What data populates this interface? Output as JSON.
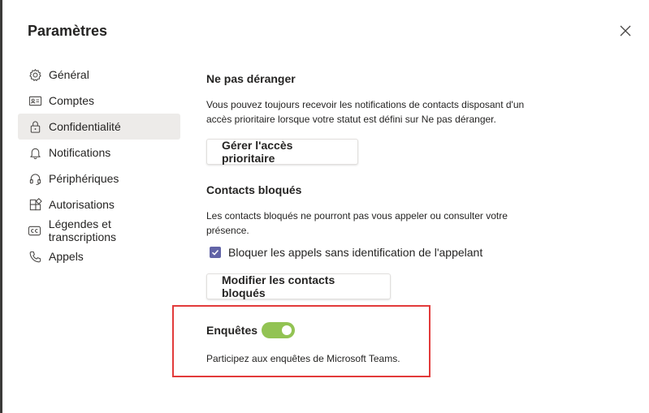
{
  "dialog": {
    "title": "Paramètres"
  },
  "sidebar": {
    "items": [
      {
        "label": "Général",
        "icon": "gear-icon"
      },
      {
        "label": "Comptes",
        "icon": "account-card-icon"
      },
      {
        "label": "Confidentialité",
        "icon": "lock-icon",
        "active": true
      },
      {
        "label": "Notifications",
        "icon": "bell-icon"
      },
      {
        "label": "Périphériques",
        "icon": "headset-icon"
      },
      {
        "label": "Autorisations",
        "icon": "apps-grid-icon"
      },
      {
        "label": "Légendes et transcriptions",
        "icon": "cc-icon"
      },
      {
        "label": "Appels",
        "icon": "phone-icon"
      }
    ]
  },
  "dnd": {
    "title": "Ne pas déranger",
    "description": "Vous pouvez toujours recevoir les notifications de contacts disposant d'un accès prioritaire lorsque votre statut est défini sur Ne pas déranger.",
    "button_label": "Gérer l'accès prioritaire"
  },
  "blocked": {
    "title": "Contacts bloqués",
    "description": "Les contacts bloqués ne pourront pas vous appeler ou consulter votre présence.",
    "checkbox_label": "Bloquer les appels sans identification de l'appelant",
    "checkbox_checked": true,
    "button_label": "Modifier les contacts bloqués"
  },
  "surveys": {
    "title": "Enquêtes",
    "toggle_on": true,
    "description": "Participez aux enquêtes de Microsoft Teams."
  },
  "colors": {
    "accent": "#6264a7",
    "toggle_on": "#92c353",
    "highlight_border": "#e23b3b",
    "active_nav_bg": "#edebe9"
  }
}
